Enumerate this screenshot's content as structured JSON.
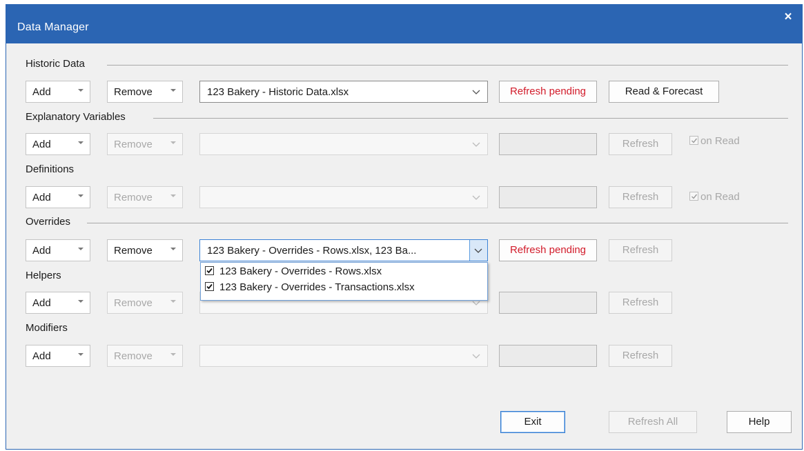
{
  "window": {
    "title": "Data Manager",
    "close_glyph": "×"
  },
  "sections": {
    "historic": "Historic Data",
    "explanatory": "Explanatory Variables",
    "definitions": "Definitions",
    "overrides": "Overrides",
    "helpers": "Helpers",
    "modifiers": "Modifiers"
  },
  "common": {
    "add": "Add",
    "remove": "Remove",
    "refresh": "Refresh",
    "refresh_pending": "Refresh pending",
    "on_read": "on Read"
  },
  "rows": {
    "historic": {
      "file": "123 Bakery - Historic Data.xlsx",
      "action": "Read & Forecast"
    },
    "overrides": {
      "file": "123 Bakery - Overrides - Rows.xlsx, 123 Ba..."
    }
  },
  "overrides_dropdown": {
    "items": [
      {
        "label": "123 Bakery - Overrides - Rows.xlsx",
        "checked": true
      },
      {
        "label": "123 Bakery - Overrides - Transactions.xlsx",
        "checked": true
      }
    ]
  },
  "footer": {
    "exit": "Exit",
    "refresh_all": "Refresh All",
    "help": "Help"
  },
  "colors": {
    "titlebar": "#2b65b3",
    "pending_text": "#d21b2a"
  },
  "icons": {
    "combo_arrow": "caret-down-icon",
    "file_chevron": "chevron-down-icon",
    "check": "checkmark-icon",
    "close": "close-icon"
  }
}
